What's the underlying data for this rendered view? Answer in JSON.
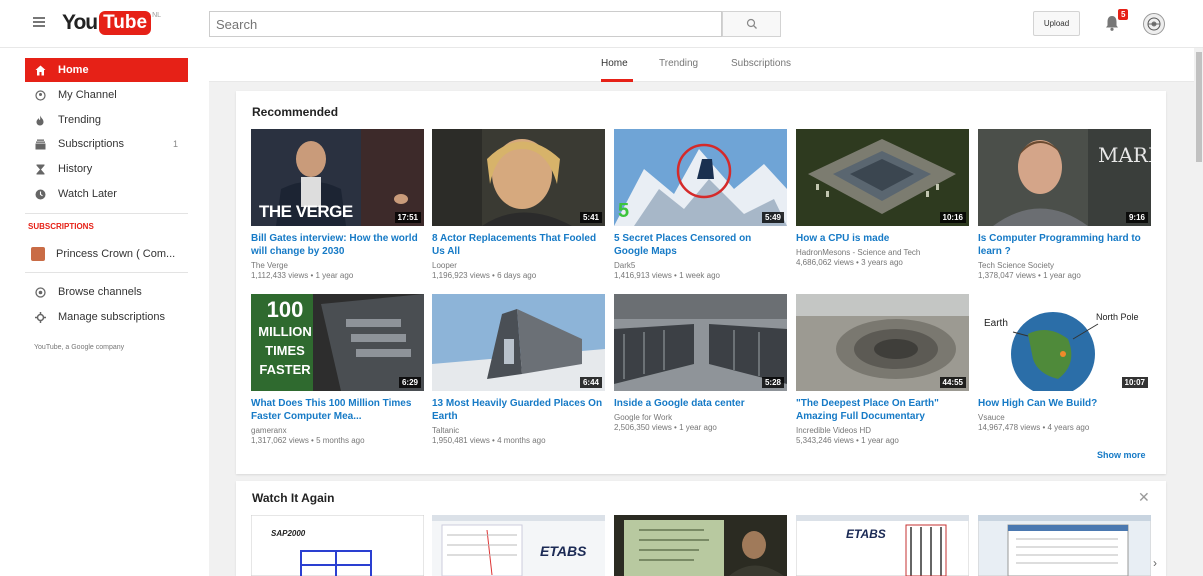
{
  "header": {
    "logo_you": "You",
    "logo_tube": "Tube",
    "logo_country": "NL",
    "search_placeholder": "Search",
    "upload_label": "Upload",
    "notification_count": "5"
  },
  "sidebar": {
    "items": [
      {
        "label": "Home",
        "icon": "home-icon"
      },
      {
        "label": "My Channel",
        "icon": "person-icon"
      },
      {
        "label": "Trending",
        "icon": "flame-icon"
      },
      {
        "label": "Subscriptions",
        "icon": "subscriptions-icon",
        "count": "1"
      },
      {
        "label": "History",
        "icon": "hourglass-icon"
      },
      {
        "label": "Watch Later",
        "icon": "clock-icon"
      }
    ],
    "subscriptions_heading": "SUBSCRIPTIONS",
    "subscription_channel": "Princess Crown ( Com...",
    "browse_channels": "Browse channels",
    "manage_subscriptions": "Manage subscriptions",
    "footer": "YouTube, a Google company"
  },
  "tabs": [
    "Home",
    "Trending",
    "Subscriptions"
  ],
  "recommended": {
    "title": "Recommended",
    "videos": [
      {
        "title": "Bill Gates interview: How the world will change by 2030",
        "channel": "The Verge",
        "meta": "1,112,433 views • 1 year ago",
        "duration": "17:51"
      },
      {
        "title": "8 Actor Replacements That Fooled Us All",
        "channel": "Looper",
        "meta": "1,196,923 views • 6 days ago",
        "duration": "5:41"
      },
      {
        "title": "5 Secret Places Censored on Google Maps",
        "channel": "Dark5",
        "meta": "1,416,913 views • 1 week ago",
        "duration": "5:49"
      },
      {
        "title": "How a CPU is made",
        "channel": "HadronMesons - Science and Tech",
        "meta": "4,686,062 views • 3 years ago",
        "duration": "10:16"
      },
      {
        "title": "Is Computer Programming hard to learn ?",
        "channel": "Tech Science Society",
        "meta": "1,378,047 views • 1 year ago",
        "duration": "9:16"
      },
      {
        "title": "What Does This 100 Million Times Faster Computer Mea...",
        "channel": "gameranx",
        "meta": "1,317,062 views • 5 months ago",
        "duration": "6:29"
      },
      {
        "title": "13 Most Heavily Guarded Places On Earth",
        "channel": "Taltanic",
        "meta": "1,950,481 views • 4 months ago",
        "duration": "6:44"
      },
      {
        "title": "Inside a Google data center",
        "channel": "Google for Work",
        "meta": "2,506,350 views • 1 year ago",
        "duration": "5:28"
      },
      {
        "title": "\"The Deepest Place On Earth\" Amazing Full Documentary",
        "channel": "Incredible Videos HD",
        "meta": "5,343,246 views • 1 year ago",
        "duration": "44:55"
      },
      {
        "title": "How High Can We Build?",
        "channel": "Vsauce",
        "meta": "14,967,478 views • 4 years ago",
        "duration": "10:07"
      }
    ],
    "thumb_text": {
      "verge": "THE VERGE",
      "mark": "MARK",
      "hundred": "100",
      "million": "MILLION",
      "times": "TIMES",
      "faster": "FASTER",
      "earth": "Earth",
      "north_pole": "North Pole"
    },
    "show_more": "Show more"
  },
  "watch_again": {
    "title": "Watch It Again",
    "thumb_text": {
      "sap": "SAP2000",
      "etabs": "ETABS"
    }
  },
  "colors": {
    "brand_red": "#e62117",
    "link_blue": "#167ac6"
  }
}
